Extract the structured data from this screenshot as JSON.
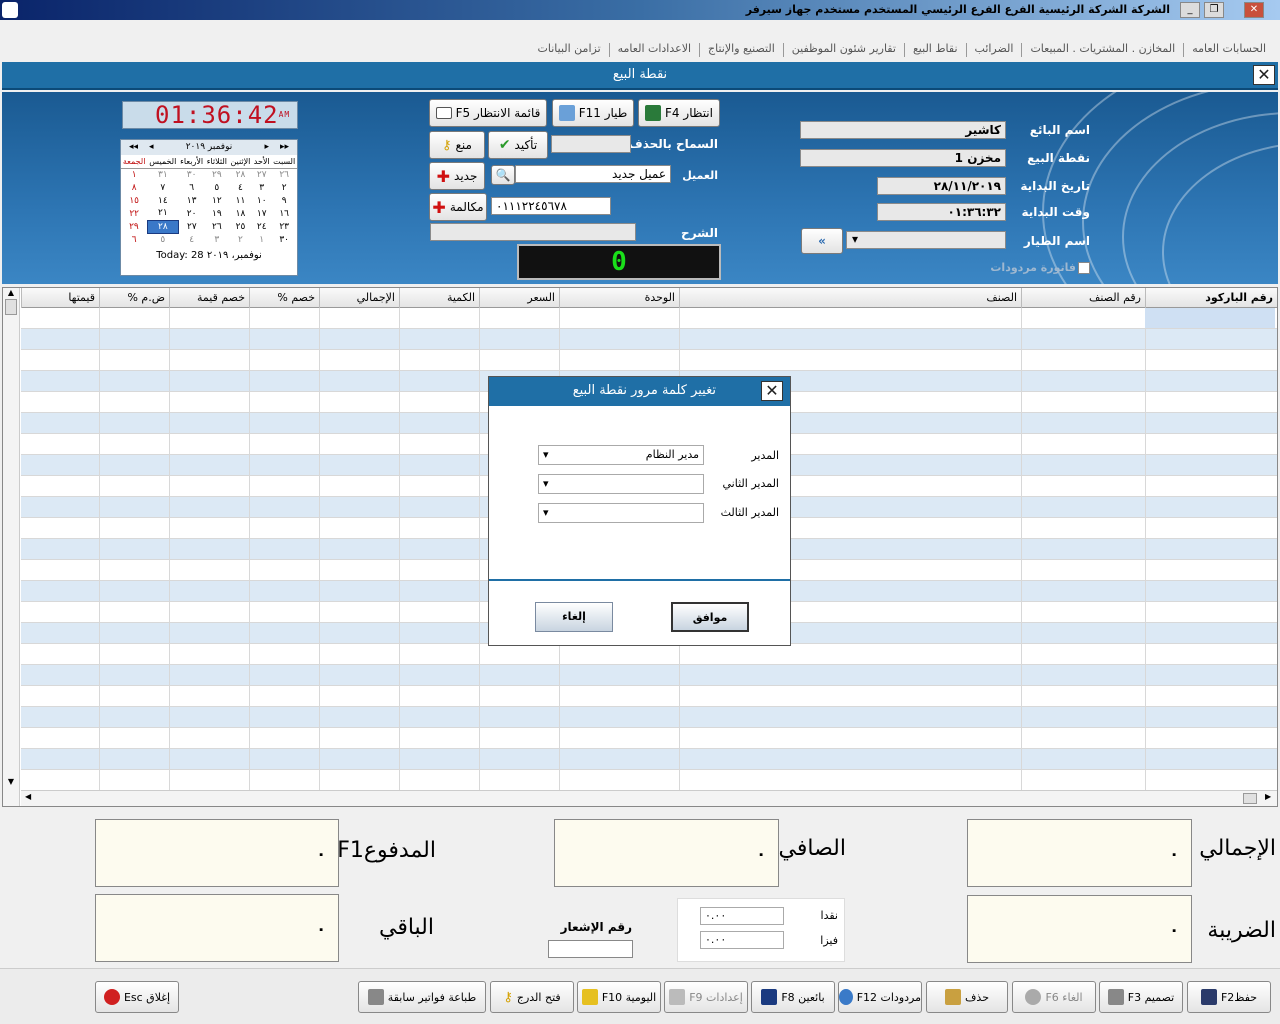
{
  "window": {
    "title": "الشركة الشركة الرئيسية   الفرع الفرع الرئيسي   المستخدم مستخدم   جهاز سيرفر",
    "btn_min": "_",
    "btn_max": "❐",
    "btn_close": "✕"
  },
  "menu": [
    "الحسابات العامه",
    "المخازن . المشتريات . المبيعات",
    "الضرائب",
    "نقاط البيع",
    "تقارير شئون الموظفين",
    "التصنيع والإنتاج",
    "الاعدادات العامه",
    "تزامن البيانات"
  ],
  "form": {
    "title": "نقطة البيع",
    "close": "✕"
  },
  "sale": {
    "seller_label": "اسم البائع",
    "seller_value": "كاشير",
    "pos_label": "نقطة البيع",
    "pos_value": "مخزن 1",
    "start_date_label": "تاريخ البداية",
    "start_date_value": "٢٨/١١/٢٠١٩",
    "start_time_label": "وقت البداية",
    "start_time_value": "٠١:٣٦:٣٢",
    "pilot_label": "اسم الطيار",
    "returns_label": "فاتورة مردودات",
    "go_button": "»"
  },
  "customer": {
    "allow_delete_label": "السماح بالحذف",
    "customer_label": "العميل",
    "customer_value": "عميل جديد",
    "phone_value": "٠١١١٢٢٤٥٦٧٨",
    "desc_label": "الشرح",
    "counter": "0"
  },
  "buttons": {
    "wait_f4": "انتظار F4",
    "pilot_f11": "طيار F11",
    "wait_list_f5": "قائمة الانتظار F5",
    "confirm": "تأكيد",
    "prevent": "منع",
    "new": "جديد",
    "call": "مكالمة"
  },
  "clock": {
    "time": "01:36:42",
    "ampm": "AM"
  },
  "calendar": {
    "month": "نوفمبر ٢٠١٩",
    "days": [
      "السبت",
      "الأحد",
      "الإثنين",
      "الثلاثاء",
      "الأربعاء",
      "الخميس",
      "الجمعة"
    ],
    "weeks": [
      [
        "٢٦",
        "٢٧",
        "٢٨",
        "٢٩",
        "٣٠",
        "٣١",
        "١"
      ],
      [
        "٢",
        "٣",
        "٤",
        "٥",
        "٦",
        "٧",
        "٨"
      ],
      [
        "٩",
        "١٠",
        "١١",
        "١٢",
        "١٣",
        "١٤",
        "١٥"
      ],
      [
        "١٦",
        "١٧",
        "١٨",
        "١٩",
        "٢٠",
        "٢١",
        "٢٢"
      ],
      [
        "٢٣",
        "٢٤",
        "٢٥",
        "٢٦",
        "٢٧",
        "٢٨",
        "٢٩"
      ],
      [
        "٣٠",
        "١",
        "٢",
        "٣",
        "٤",
        "٥",
        "٦"
      ]
    ],
    "today": "Today: 28 نوفمبر، ٢٠١٩"
  },
  "grid": {
    "columns": [
      "رقم الباركود",
      "رقم الصنف",
      "الصنف",
      "الوحدة",
      "السعر",
      "الكمية",
      "الإجمالي",
      "خصم %",
      "خصم قيمة",
      "ض.م %",
      "قيمتها"
    ]
  },
  "dialog": {
    "title": "تغيير كلمة مرور نقطة البيع",
    "close": "✕",
    "manager_label": "المدير",
    "manager_value": "مدير النظام",
    "manager2_label": "المدير الثاني",
    "manager3_label": "المدير الثالث",
    "ok": "موافق",
    "cancel": "إلغاء"
  },
  "totals": {
    "total_label": "الإجمالي",
    "total_value": "٠",
    "net_label": "الصافي",
    "net_value": "٠",
    "paid_label": "المدفوعF1",
    "paid_value": "٠",
    "tax_label": "الضريبة",
    "tax_value": "٠",
    "remain_label": "الباقي",
    "remain_value": "٠",
    "notice_label": "رقم الإشعار",
    "cash_label": "نقدا",
    "cash_value": "٠.٠٠",
    "visa_label": "فيزا",
    "visa_value": "٠.٠٠"
  },
  "footer": {
    "save": "حفظF2",
    "print": "تصميم F3",
    "cancel": "الغاء F6",
    "delete": "حذف",
    "returns": "مردودات F12",
    "sellers": "بائعين F8",
    "settings": "إعدادات F9",
    "daily": "اليومية F10",
    "drawer": "فتح الدرج",
    "print_prev": "طباعة فواتير سابقة",
    "close": "إغلاق Esc"
  }
}
